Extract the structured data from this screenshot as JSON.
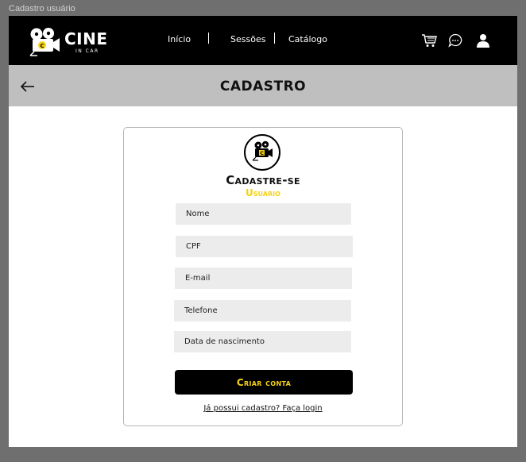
{
  "frame": {
    "label": "Cadastro usuário"
  },
  "brand": {
    "name": "CINE",
    "tagline": "IN CAR",
    "accent_color": "#f6d214",
    "nav_background": "#000000"
  },
  "nav": {
    "links": [
      "Início",
      "Sessões",
      "Catálogo"
    ],
    "icons": [
      "cart-icon",
      "chat-icon",
      "user-icon"
    ]
  },
  "titlebar": {
    "title": "CADASTRO",
    "back_icon": "arrow-left-icon"
  },
  "form": {
    "heading": "Cadastre-se",
    "subheading": "Usuário",
    "fields": {
      "name": "Nome",
      "cpf": "CPF",
      "email": "E-mail",
      "phone": "Telefone",
      "birthdate": "Data de nascimento"
    },
    "submit_label": "Criar conta",
    "login_link": "Já possui cadastro? Faça login"
  }
}
